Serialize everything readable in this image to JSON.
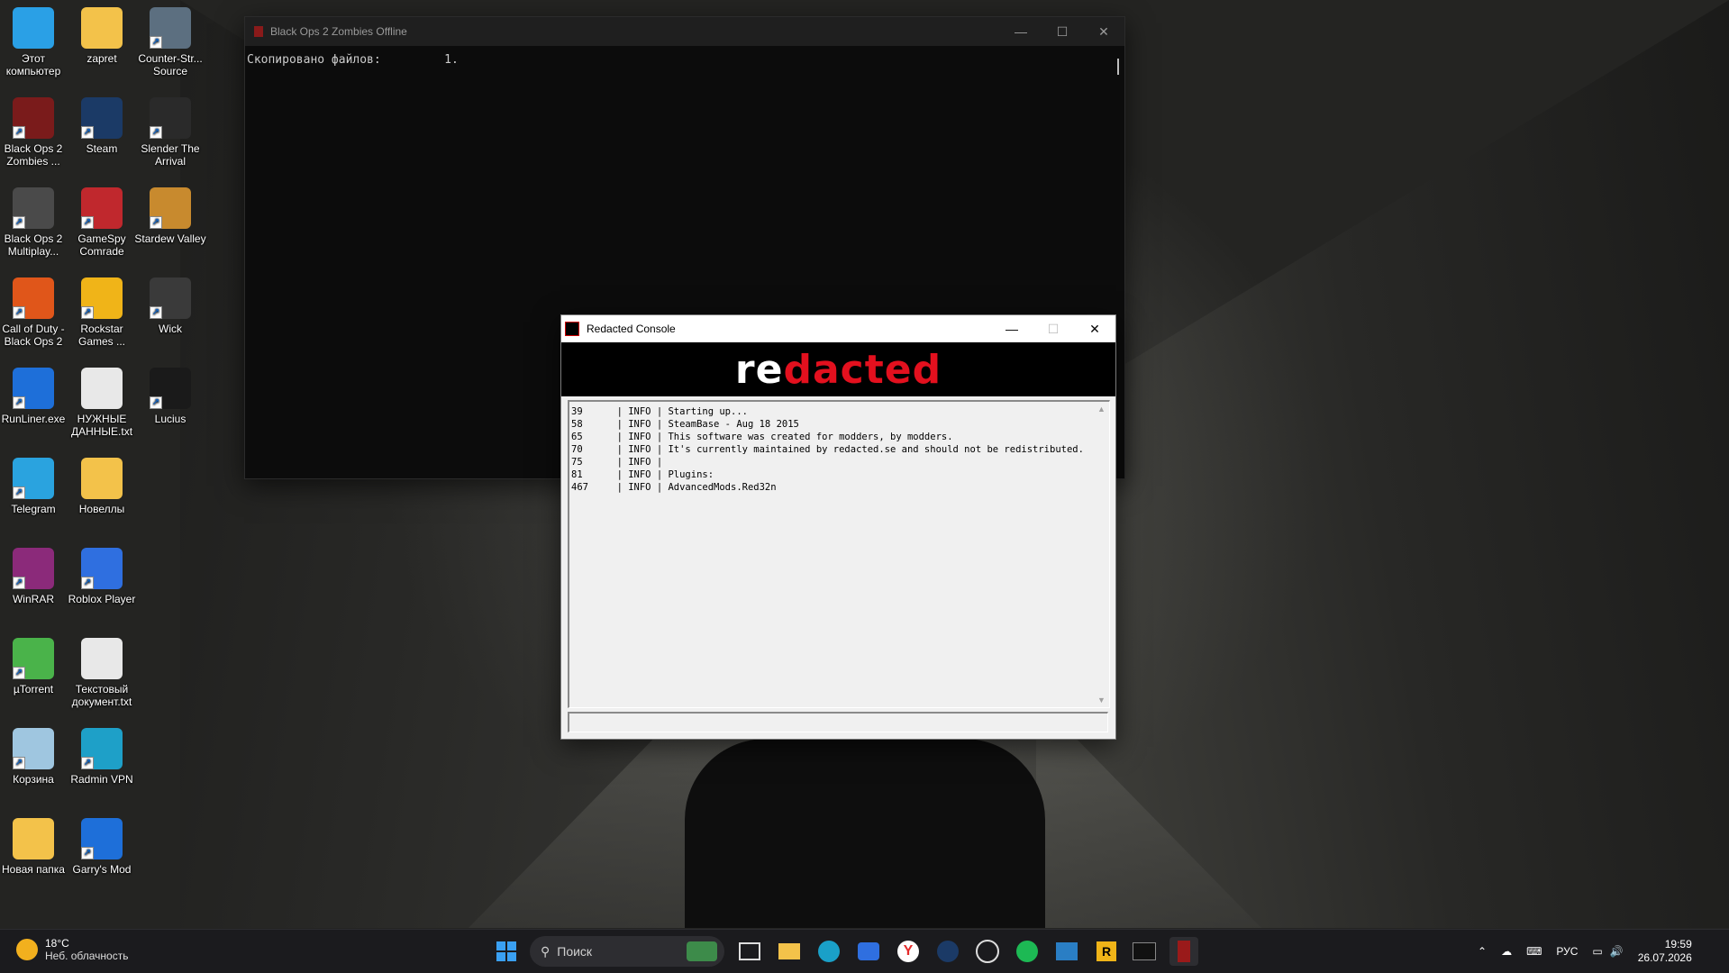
{
  "desktop_icons": [
    {
      "label": "Этот компьютер",
      "icon": "computer-icon",
      "color": "#2aa0e6"
    },
    {
      "label": "zapret",
      "icon": "folder-icon",
      "color": "#f3c24a"
    },
    {
      "label": "Counter-Str... Source",
      "icon": "counter-strike-icon",
      "color": "#5c6f80"
    },
    {
      "label": "Black Ops 2 Zombies ...",
      "icon": "black-ops-icon",
      "color": "#7a1b1b"
    },
    {
      "label": "Steam",
      "icon": "steam-icon",
      "color": "#1b3a66"
    },
    {
      "label": "Slender The Arrival",
      "icon": "slender-icon",
      "color": "#2a2a2a"
    },
    {
      "label": "Black Ops 2 Multiplay...",
      "icon": "black-ops-icon",
      "color": "#4a4a4a"
    },
    {
      "label": "GameSpy Comrade",
      "icon": "gamespy-icon",
      "color": "#c0282d"
    },
    {
      "label": "Stardew Valley",
      "icon": "stardew-icon",
      "color": "#c88a2e"
    },
    {
      "label": "Call of Duty - Black Ops 2",
      "icon": "black-ops-icon",
      "color": "#e0561a"
    },
    {
      "label": "Rockstar Games ...",
      "icon": "rockstar-icon",
      "color": "#f0b418"
    },
    {
      "label": "Wick",
      "icon": "wick-icon",
      "color": "#3a3a3a"
    },
    {
      "label": "RunLiner.exe",
      "icon": "app-icon",
      "color": "#1e6fd9"
    },
    {
      "label": "НУЖНЫЕ ДАННЫЕ.txt",
      "icon": "text-file-icon",
      "color": "#e8e8e8"
    },
    {
      "label": "Lucius",
      "icon": "lucius-icon",
      "color": "#1a1a1a"
    },
    {
      "label": "Telegram",
      "icon": "telegram-icon",
      "color": "#2aa3df"
    },
    {
      "label": "Новеллы",
      "icon": "folder-icon",
      "color": "#f3c24a"
    },
    {
      "label": "WinRAR",
      "icon": "winrar-icon",
      "color": "#8b2a7a"
    },
    {
      "label": "Roblox Player",
      "icon": "roblox-icon",
      "color": "#2f6fe0"
    },
    {
      "label": "µTorrent",
      "icon": "utorrent-icon",
      "color": "#4ab34a"
    },
    {
      "label": "Текстовый документ.txt",
      "icon": "text-file-icon",
      "color": "#e8e8e8"
    },
    {
      "label": "Корзина",
      "icon": "recycle-bin-icon",
      "color": "#9fc6e0"
    },
    {
      "label": "Radmin VPN",
      "icon": "radmin-vpn-icon",
      "color": "#1ea0c8"
    },
    {
      "label": "Новая папка",
      "icon": "folder-icon",
      "color": "#f3c24a"
    },
    {
      "label": "Garry's Mod",
      "icon": "garrys-mod-icon",
      "color": "#1e6fd9"
    }
  ],
  "terminal": {
    "title": "Black Ops 2 Zombies Offline",
    "output": "Скопировано файлов:         1."
  },
  "console": {
    "title": "Redacted Console",
    "banner_left": "re",
    "banner_right": "dacted",
    "log": [
      "39      | INFO | Starting up...",
      "58      | INFO | SteamBase - Aug 18 2015",
      "65      | INFO | This software was created for modders, by modders.",
      "70      | INFO | It's currently maintained by redacted.se and should not be redistributed.",
      "75      | INFO |",
      "81      | INFO | Plugins:",
      "467     | INFO | AdvancedMods.Red32n"
    ],
    "input_value": ""
  },
  "taskbar": {
    "weather_temp": "18°C",
    "weather_desc": "Неб. облачность",
    "search_placeholder": "Поиск",
    "language": "РУС",
    "time": "19:59",
    "date": "26.07.2026"
  }
}
